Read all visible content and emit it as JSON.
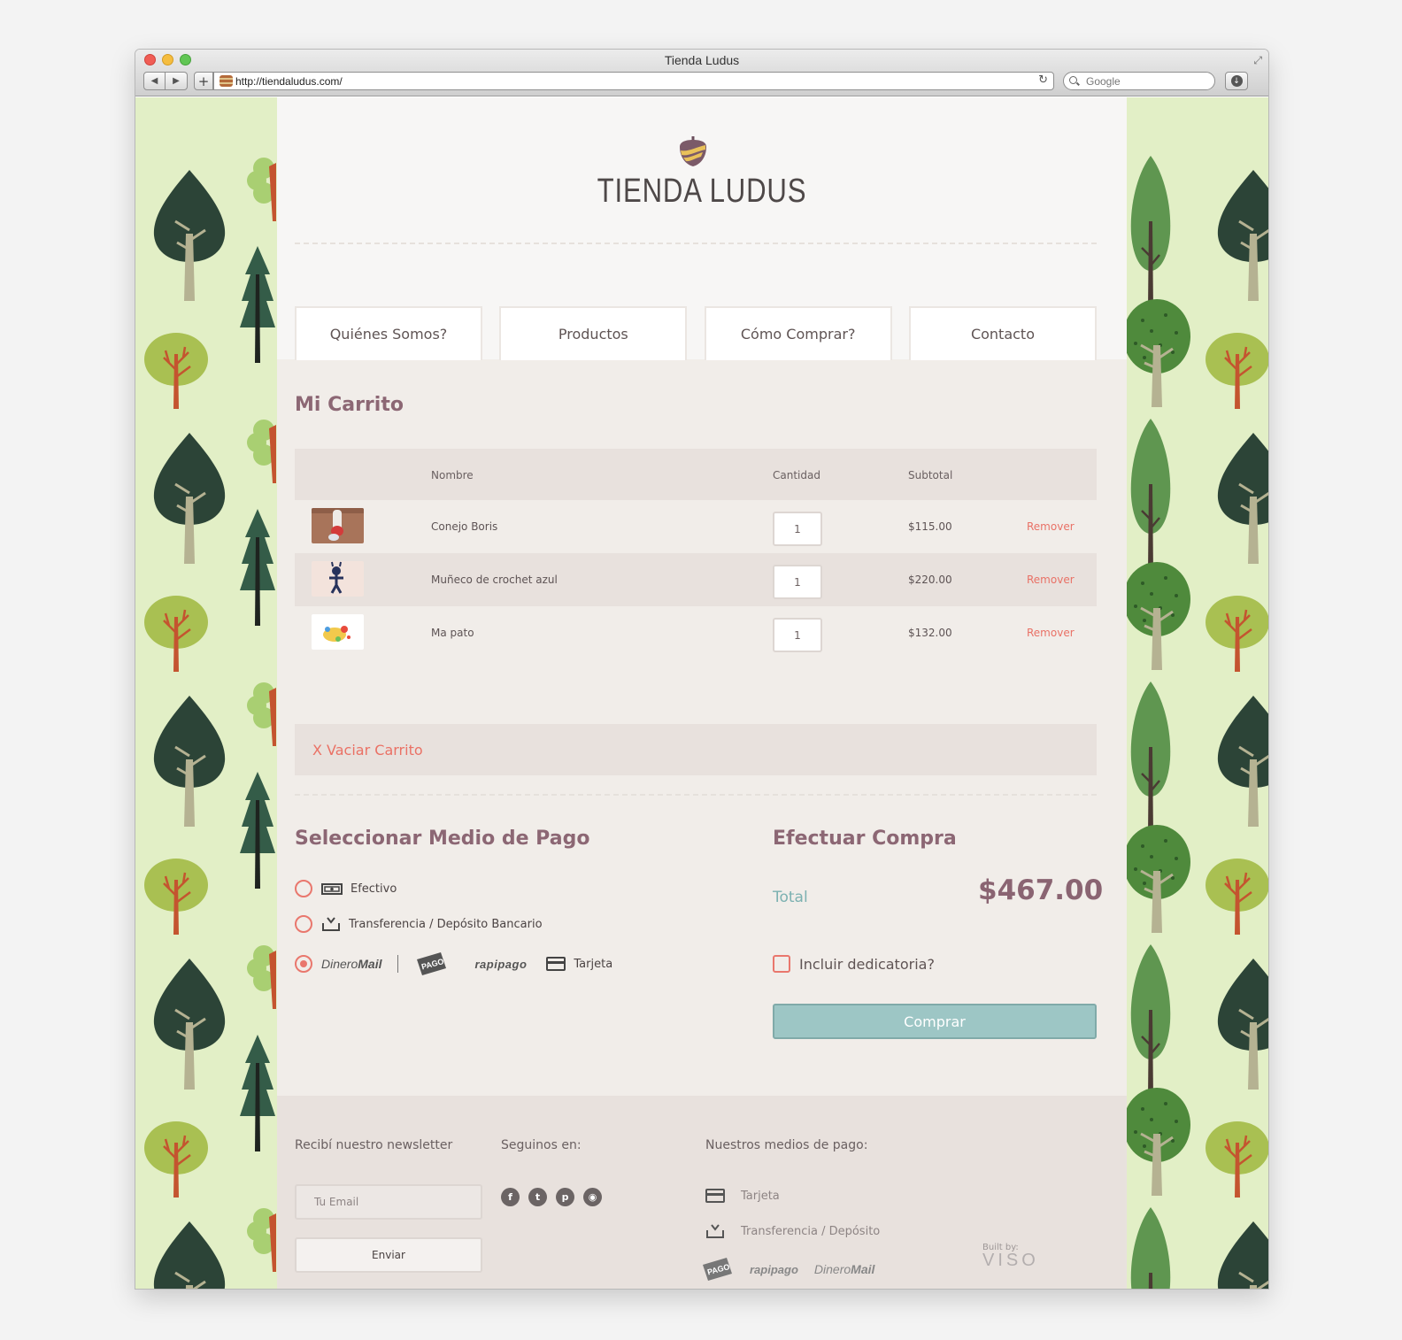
{
  "browser": {
    "window_title": "Tienda Ludus",
    "url": "http://tiendaludus.com/",
    "search_placeholder": "Google"
  },
  "site": {
    "logo_text": "TIENDA LUDUS",
    "nav": [
      "Quiénes Somos?",
      "Productos",
      "Cómo Comprar?",
      "Contacto"
    ]
  },
  "cart": {
    "title": "Mi Carrito",
    "columns": {
      "name": "Nombre",
      "qty": "Cantidad",
      "subtotal": "Subtotal"
    },
    "items": [
      {
        "name": "Conejo Boris",
        "qty": "1",
        "subtotal": "$115.00",
        "remove": "Remover"
      },
      {
        "name": "Muñeco de crochet azul",
        "qty": "1",
        "subtotal": "$220.00",
        "remove": "Remover"
      },
      {
        "name": "Ma pato",
        "qty": "1",
        "subtotal": "$132.00",
        "remove": "Remover"
      }
    ],
    "empty_label": "X Vaciar Carrito"
  },
  "payment": {
    "title": "Seleccionar Medio de Pago",
    "options": [
      {
        "label": "Efectivo",
        "selected": false,
        "icon": "cash-icon"
      },
      {
        "label": "Transferencia / Depósito Bancario",
        "selected": false,
        "icon": "bank-transfer-icon"
      },
      {
        "label": "Tarjeta",
        "selected": true,
        "icon": "credit-card-icon"
      }
    ],
    "brands": {
      "dineromail_a": "Dinero",
      "dineromail_b": "Mail",
      "pagofacil": "PAGO",
      "rapipago": "rapipago"
    }
  },
  "checkout": {
    "title": "Efectuar Compra",
    "total_label": "Total",
    "total_value": "$467.00",
    "dedication_label": "Incluir dedicatoria?",
    "buy_label": "Comprar"
  },
  "footer": {
    "newsletter_title": "Recibí nuestro newsletter",
    "email_placeholder": "Tu Email",
    "send_label": "Enviar",
    "follow_title": "Seguinos en:",
    "social": [
      "facebook-icon",
      "twitter-icon",
      "pinterest-icon",
      "rss-icon"
    ],
    "payments_title": "Nuestros medios de pago:",
    "payments": [
      "Tarjeta",
      "Transferencia / Depósito"
    ],
    "built_by": "Built by:",
    "builder": "VISO"
  },
  "colors": {
    "accent_plum": "#8c6774",
    "accent_coral": "#e9776d",
    "accent_teal": "#9dc6c5",
    "forest_bg": "#e2efc6"
  }
}
